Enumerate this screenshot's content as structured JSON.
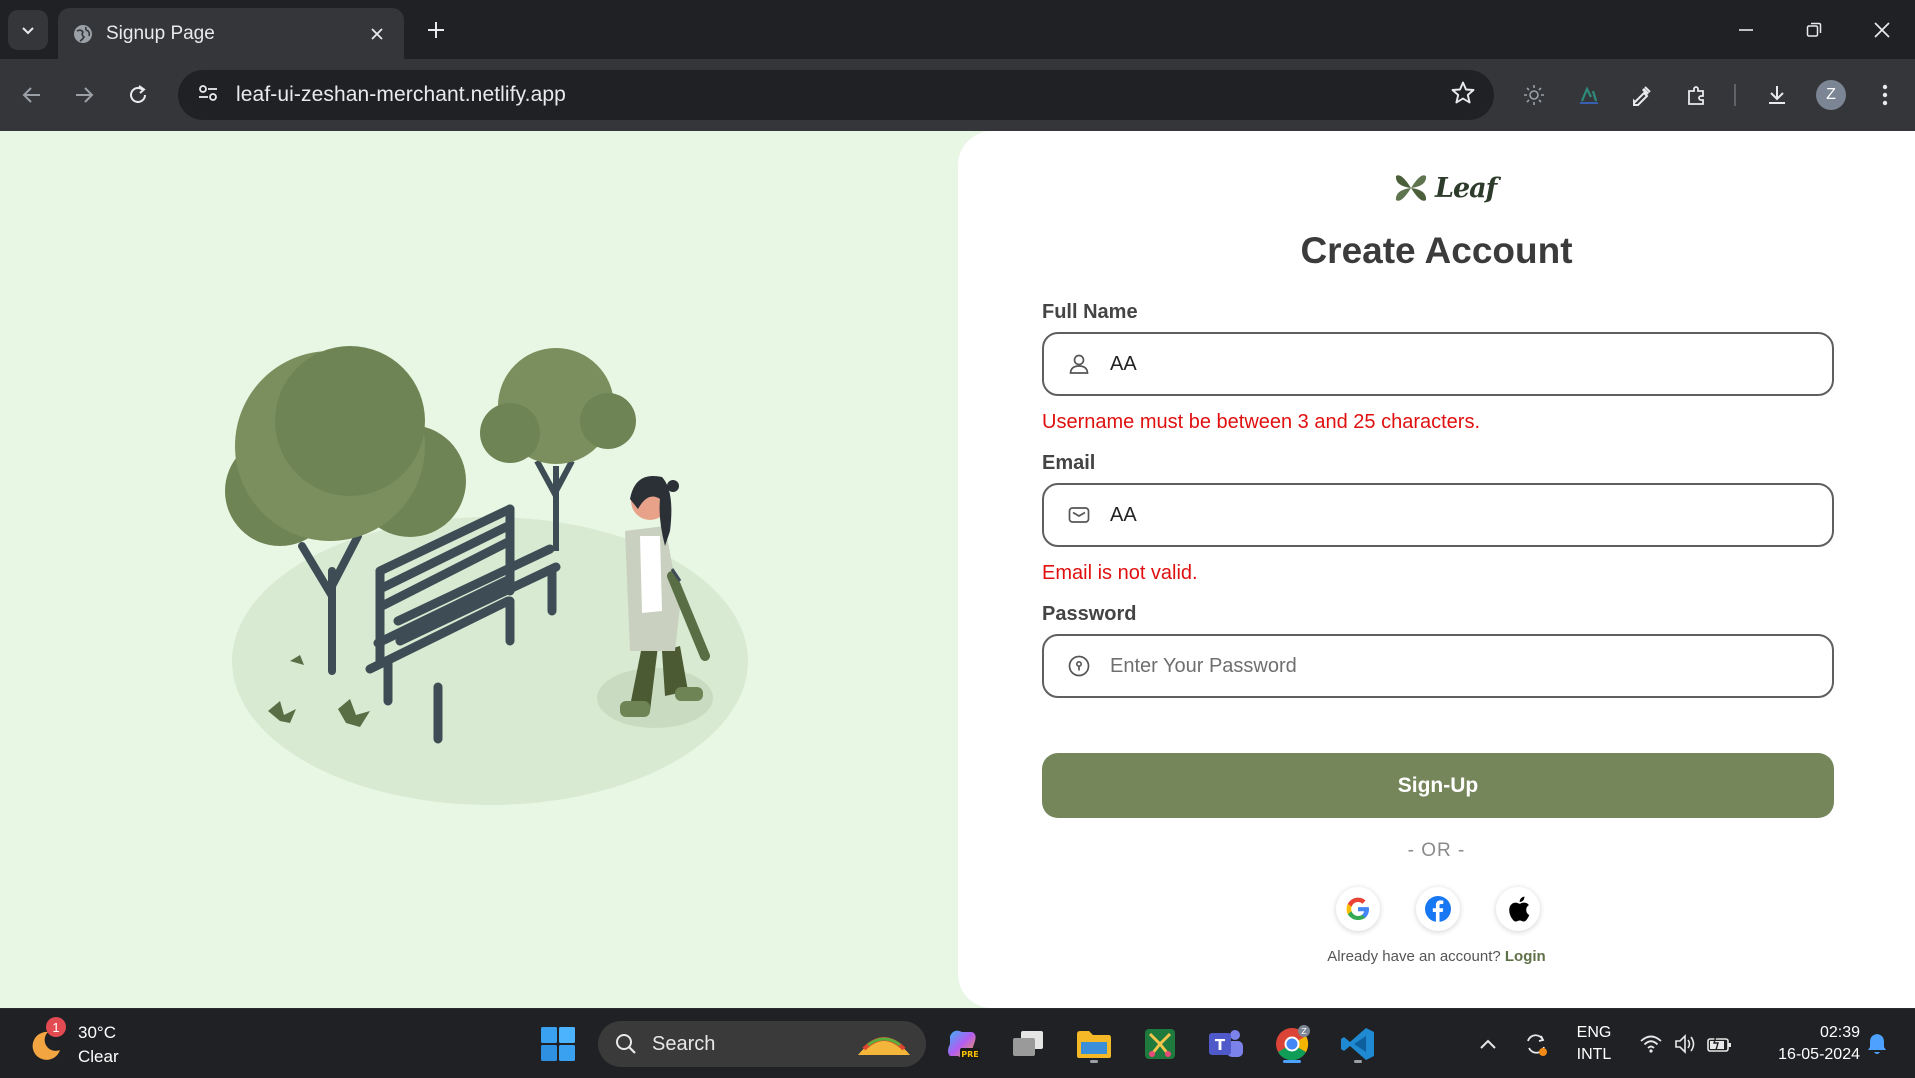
{
  "browser": {
    "tab_title": "Signup Page",
    "url": "leaf-ui-zeshan-merchant.netlify.app",
    "profile_initial": "Z"
  },
  "page": {
    "logo_text": "Leaf",
    "heading": "Create Account",
    "full_name": {
      "label": "Full Name",
      "value": "AA",
      "error": "Username must be between 3 and 25 characters."
    },
    "email": {
      "label": "Email",
      "value": "AA",
      "error": "Email is not valid."
    },
    "password": {
      "label": "Password",
      "placeholder": "Enter Your Password"
    },
    "signup_label": "Sign-Up",
    "or_text": "- OR -",
    "login_prompt": "Already have an account?",
    "login_link": "Login",
    "colors": {
      "accent": "#75875a",
      "error": "#e01010",
      "page_bg": "#e8f7e4"
    }
  },
  "taskbar": {
    "weather_temp": "30°C",
    "weather_desc": "Clear",
    "weather_badge": "1",
    "search_label": "Search",
    "lang_line1": "ENG",
    "lang_line2": "INTL",
    "time": "02:39",
    "date": "16-05-2024"
  }
}
